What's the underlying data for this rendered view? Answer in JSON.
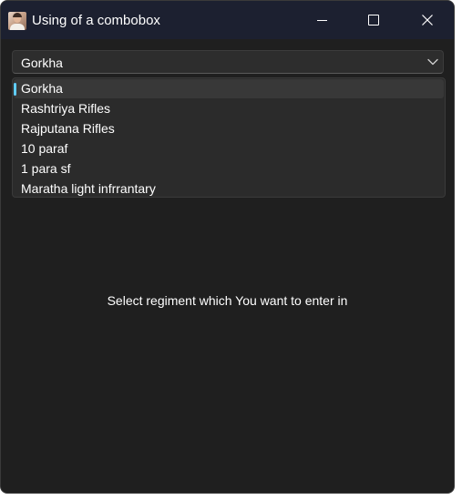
{
  "window": {
    "title": "Using of a combobox",
    "icon": "user-photo-icon"
  },
  "titlebar_buttons": {
    "minimize": "minimize-icon",
    "maximize": "maximize-icon",
    "close": "close-icon"
  },
  "combobox": {
    "selected": "Gorkha",
    "chevron": "chevron-down-icon",
    "options": [
      "Gorkha",
      "Rashtriya Rifles",
      "Rajputana Rifles",
      "10 paraf",
      "1 para sf",
      "Maratha light infrrantary"
    ],
    "selected_index": 0
  },
  "main": {
    "prompt": "Select regiment which You want to enter in"
  },
  "colors": {
    "window_bg": "#1f1f1f",
    "titlebar_bg": "#1c2030",
    "accent": "#60cdff",
    "text": "#ffffff"
  }
}
